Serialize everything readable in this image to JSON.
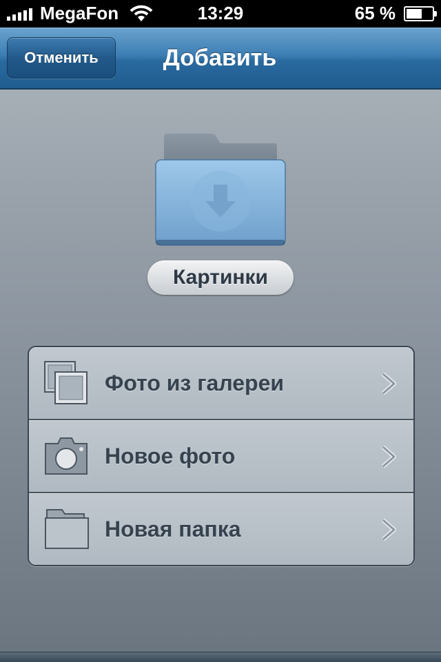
{
  "status_bar": {
    "carrier": "MegaFon",
    "time": "13:29",
    "battery_percent": "65 %",
    "battery_level": 0.65,
    "signal_icon": "signal-bars-icon",
    "wifi_icon": "wifi-icon",
    "battery_icon": "battery-icon"
  },
  "nav": {
    "cancel_label": "Отменить",
    "title": "Добавить"
  },
  "folder": {
    "icon": "download-folder-icon",
    "name": "Картинки",
    "color": "#7fb0d8"
  },
  "options": [
    {
      "label": "Фото из галереи",
      "icon": "photo-gallery-icon"
    },
    {
      "label": "Новое фото",
      "icon": "camera-icon"
    },
    {
      "label": "Новая папка",
      "icon": "folder-icon"
    }
  ],
  "colors": {
    "nav_bar": "#2a6a9f",
    "background": "#98a1aa",
    "label_text": "#36434f"
  }
}
